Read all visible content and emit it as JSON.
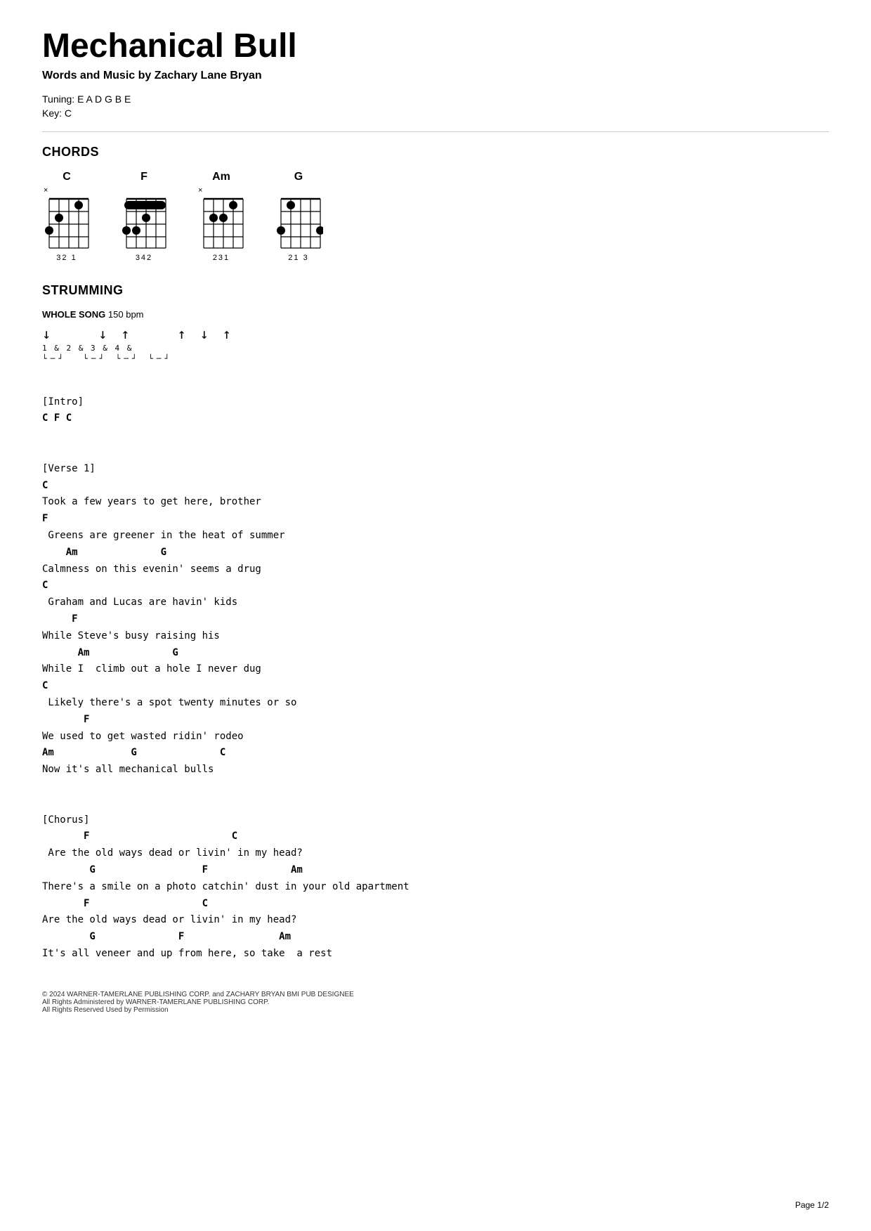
{
  "title": "Mechanical Bull",
  "subtitle": "Words and Music by Zachary Lane Bryan",
  "tuning": "Tuning: E A D G B E",
  "key": "Key: C",
  "sections": {
    "chords_heading": "CHORDS",
    "strumming_heading": "STRUMMING",
    "whole_song_label": "WHOLE SONG",
    "bpm": "150 bpm"
  },
  "chords": [
    {
      "name": "C",
      "mute_top": "×",
      "mute_bottom": "",
      "fingers": "32 1"
    },
    {
      "name": "F",
      "mute_top": "",
      "mute_bottom": "",
      "fingers": "342"
    },
    {
      "name": "Am",
      "mute_top": "×",
      "mute_bottom": "",
      "fingers": "231"
    },
    {
      "name": "G",
      "mute_top": "",
      "mute_bottom": "",
      "fingers": "21    3"
    }
  ],
  "strum_pattern": "↓   ↓ ↑   ↑ ↓ ↑",
  "strum_beats": "1 & 2 & 3 & 4 &",
  "strum_brackets": "└─┘  └─┘ └─┘ └─┘",
  "song_lines": [
    {
      "type": "blank",
      "text": ""
    },
    {
      "type": "section",
      "text": "[Intro]"
    },
    {
      "type": "chord",
      "text": "C F C"
    },
    {
      "type": "blank",
      "text": ""
    },
    {
      "type": "blank",
      "text": ""
    },
    {
      "type": "section",
      "text": "[Verse 1]"
    },
    {
      "type": "chord",
      "text": "C"
    },
    {
      "type": "lyric",
      "text": "Took a few years to get here, brother"
    },
    {
      "type": "chord",
      "text": "F"
    },
    {
      "type": "lyric",
      "text": " Greens are greener in the heat of summer"
    },
    {
      "type": "chord",
      "text": "    Am              G"
    },
    {
      "type": "lyric",
      "text": "Calmness on this evenin' seems a drug"
    },
    {
      "type": "chord",
      "text": "C"
    },
    {
      "type": "lyric",
      "text": " Graham and Lucas are havin' kids"
    },
    {
      "type": "chord",
      "text": "     F"
    },
    {
      "type": "lyric",
      "text": "While Steve's busy raising his"
    },
    {
      "type": "chord",
      "text": "      Am              G"
    },
    {
      "type": "lyric",
      "text": "While I  climb out a hole I never dug"
    },
    {
      "type": "chord",
      "text": "C"
    },
    {
      "type": "lyric",
      "text": " Likely there's a spot twenty minutes or so"
    },
    {
      "type": "chord",
      "text": "       F"
    },
    {
      "type": "lyric",
      "text": "We used to get wasted ridin' rodeo"
    },
    {
      "type": "chord",
      "text": "Am             G              C"
    },
    {
      "type": "lyric",
      "text": "Now it's all mechanical bulls"
    },
    {
      "type": "blank",
      "text": ""
    },
    {
      "type": "blank",
      "text": ""
    },
    {
      "type": "section",
      "text": "[Chorus]"
    },
    {
      "type": "chord",
      "text": "       F                        C"
    },
    {
      "type": "lyric",
      "text": " Are the old ways dead or livin' in my head?"
    },
    {
      "type": "chord",
      "text": "        G                  F              Am"
    },
    {
      "type": "lyric",
      "text": "There's a smile on a photo catchin' dust in your old apartment"
    },
    {
      "type": "chord",
      "text": "       F                   C"
    },
    {
      "type": "lyric",
      "text": "Are the old ways dead or livin' in my head?"
    },
    {
      "type": "chord",
      "text": "        G              F                Am"
    },
    {
      "type": "lyric",
      "text": "It's all veneer and up from here, so take  a rest"
    }
  ],
  "footer": {
    "line1": "© 2024 WARNER-TAMERLANE PUBLISHING CORP. and ZACHARY BRYAN BMI PUB DESIGNEE",
    "line2": "All Rights Administered by WARNER-TAMERLANE PUBLISHING CORP.",
    "line3": "All Rights Reserved   Used by Permission"
  },
  "page_num": "Page 1/2"
}
